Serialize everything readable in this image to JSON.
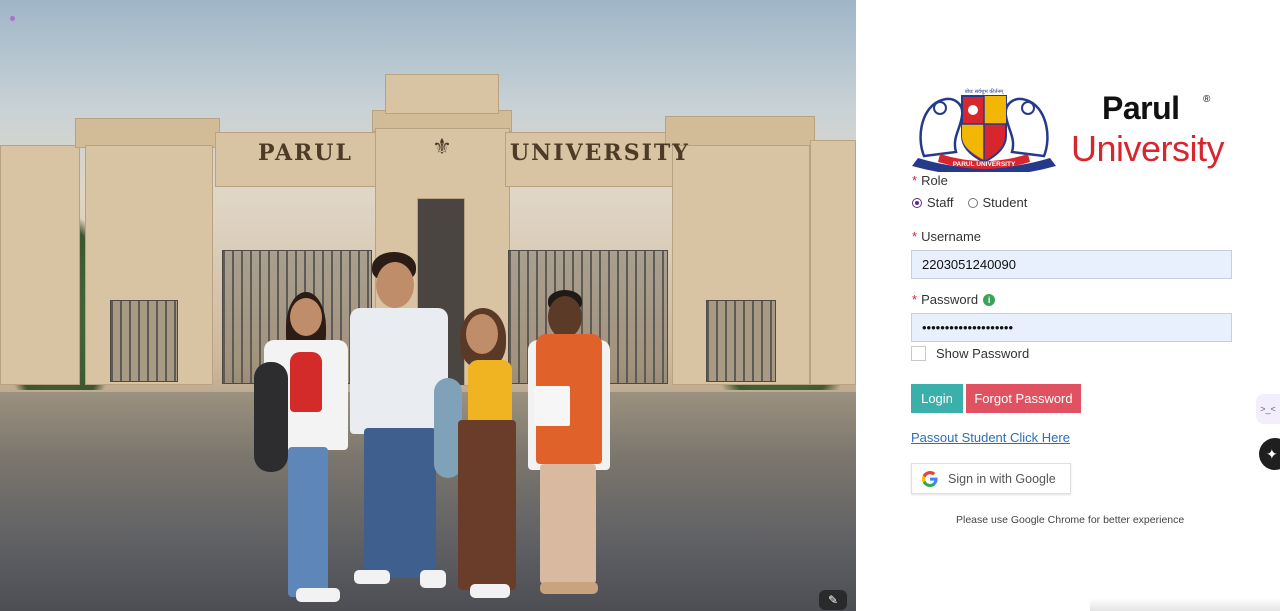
{
  "hero": {
    "sign_left": "PARUL",
    "sign_right": "UNIVERSITY",
    "magic_icon": "magic-wand-icon"
  },
  "brand": {
    "name_line1": "Parul",
    "registered": "®",
    "name_line2": "University",
    "emblem_motto": "बोधः सर्वशुभ कीर्तनम्",
    "emblem_ribbon": "PARUL UNIVERSITY",
    "colors": {
      "red": "#d7262e",
      "navy": "#263a8c",
      "gold": "#f2b705"
    }
  },
  "form": {
    "role_label": "Role",
    "role_options": [
      "Staff",
      "Student"
    ],
    "role_selected": "Staff",
    "username_label": "Username",
    "username_value": "2203051240090",
    "password_label": "Password",
    "password_value": "••••••••••••••••••••",
    "show_password_label": "Show Password",
    "login_label": "Login",
    "forgot_label": "Forgot Password",
    "passout_link": "Passout Student Click Here",
    "google_label": "Sign in with Google",
    "browser_note": "Please use Google Chrome for better experience"
  },
  "colors": {
    "login_button": "#3bafa9",
    "forgot_button": "#e05262",
    "input_background": "#e8f0fe",
    "link": "#2a6fba"
  },
  "side": {
    "chip_text": ">_<",
    "fab_icon": "sparkle-icon"
  }
}
